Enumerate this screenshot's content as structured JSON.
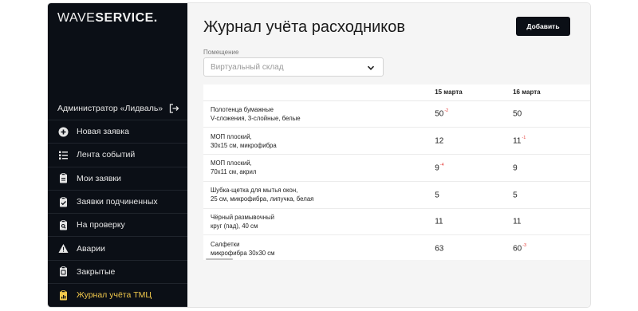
{
  "logo": {
    "part1": "WAVE",
    "part2": "SERVICE."
  },
  "sidebar": {
    "admin_label": "Администратор «Лидваль»",
    "items": [
      {
        "label": "Новая заявка",
        "icon": "plus-circle-icon"
      },
      {
        "label": "Лента событий",
        "icon": "list-icon"
      },
      {
        "label": "Мои заявки",
        "icon": "clipboard-icon"
      },
      {
        "label": "Заявки подчиненных",
        "icon": "clipboard-check-icon"
      },
      {
        "label": "На проверку",
        "icon": "clipboard-search-icon"
      },
      {
        "label": "Аварии",
        "icon": "warning-icon"
      },
      {
        "label": "Закрытые",
        "icon": "clipboard-closed-icon"
      },
      {
        "label": "Журнал учёта ТМЦ",
        "icon": "journal-icon"
      }
    ],
    "active_index": 7
  },
  "header": {
    "title": "Журнал учёта расходников",
    "add_label": "Добавить"
  },
  "filter": {
    "label": "Помещение",
    "value": "Виртуальный склад"
  },
  "table": {
    "columns": [
      "",
      "15 марта",
      "16 марта"
    ],
    "rows": [
      {
        "name_line1": "Полотенца бумажные",
        "name_line2": "V-сложения, 3-слойные, белые",
        "v1": "50",
        "d1": "-2",
        "v2": "50",
        "d2": ""
      },
      {
        "name_line1": "МОП плоский,",
        "name_line2": "30x15 см, микрофибра",
        "v1": "12",
        "d1": "",
        "v2": "11",
        "d2": "-1"
      },
      {
        "name_line1": "МОП плоский,",
        "name_line2": "70x11 см, акрил",
        "v1": "9",
        "d1": "-4",
        "v2": "9",
        "d2": ""
      },
      {
        "name_line1": "Шубка-щетка для мытья окон,",
        "name_line2": "25 см, микрофибра, липучка, белая",
        "v1": "5",
        "d1": "",
        "v2": "5",
        "d2": ""
      },
      {
        "name_line1": "Чёрный размывочный",
        "name_line2": "круг (пад), 40 см",
        "v1": "11",
        "d1": "",
        "v2": "11",
        "d2": ""
      },
      {
        "name_line1": "Салфетки",
        "name_line2": "микрофибра 30x30 см",
        "v1": "63",
        "d1": "",
        "v2": "60",
        "d2": "-3"
      }
    ]
  },
  "colors": {
    "sidebar_bg": "#0b0f16",
    "active": "#f2c94c",
    "delta": "#e53935",
    "main_bg": "#f5f5f5"
  }
}
